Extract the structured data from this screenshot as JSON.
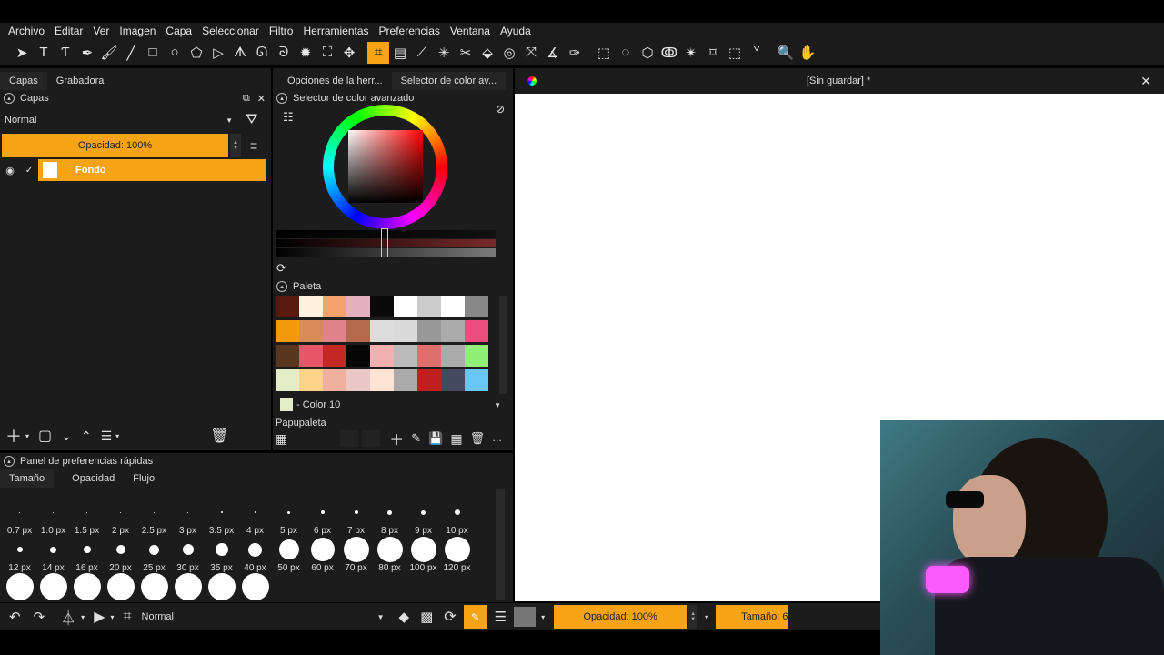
{
  "menu": [
    "Archivo",
    "Editar",
    "Ver",
    "Imagen",
    "Capa",
    "Seleccionar",
    "Filtro",
    "Herramientas",
    "Preferencias",
    "Ventana",
    "Ayuda"
  ],
  "toolbar_icons": [
    "select-arrow-icon",
    "text-icon",
    "transform-text-icon",
    "pen-icon",
    "brush-icon",
    "line-icon",
    "rectangle-icon",
    "ellipse-icon",
    "polygon-icon",
    "arrow-shape-icon",
    "bezier-icon",
    "lasso-curve-icon",
    "curve-icon",
    "spray-icon",
    "frame-icon",
    "move-icon",
    "crop-icon",
    "gradient-icon",
    "eyedropper-icon",
    "magic-icon",
    "scissors-icon",
    "fill-bucket-icon",
    "target-icon",
    "transform-icon",
    "ruler-icon",
    "pin-icon",
    "rect-select-icon",
    "ellipse-select-icon",
    "poly-select-icon",
    "freehand-select-icon",
    "magic-wand-icon",
    "select-transform-icon",
    "select-frame-icon",
    "select-curve-icon",
    "zoom-icon",
    "hand-icon"
  ],
  "left_tabs": [
    "Capas",
    "Grabadora"
  ],
  "layers": {
    "title": "Capas",
    "blend_mode": "Normal",
    "opacity_label": "Opacidad:  100%",
    "layer_name": "Fondo"
  },
  "mid_tabs": [
    "Opciones de la herr...",
    "Selector de color av..."
  ],
  "color_selector": {
    "title": "Selector de color avanzado"
  },
  "palette": {
    "title": "Paleta",
    "selected_color": "- Color 10",
    "papupaleta": "Papupaleta",
    "colors": [
      "#5a1a10",
      "#fff3e0",
      "#f4a26b",
      "#e4b0c0",
      "#0a0a0a",
      "#ffffff",
      "#cccccc",
      "#ffffff",
      "#888888",
      "#f39a0c",
      "#d98c5a",
      "#e0828a",
      "#b5694a",
      "#dcdcdc",
      "#d9d9d9",
      "#999999",
      "#aaaaaa",
      "#ec4d7f",
      "#5a3520",
      "#e8566a",
      "#c42825",
      "#060606",
      "#f4b0b0",
      "#bbbbbb",
      "#e07070",
      "#aaaaaa",
      "#8ef074",
      "#e4ecc8",
      "#ffd28a",
      "#f0b0a0",
      "#ebc8c8",
      "#ffe4d6",
      "#aaaaaa",
      "#c02020",
      "#444a60",
      "#6ac6f4"
    ]
  },
  "quick_prefs": {
    "title": "Panel de preferencias rápidas",
    "tabs": [
      "Tamaño",
      "Opacidad",
      "Flujo"
    ],
    "row1": [
      "0.7 px",
      "1.0 px",
      "1.5 px",
      "2 px",
      "2.5 px",
      "3 px",
      "3.5 px",
      "4 px",
      "5 px",
      "6 px",
      "7 px",
      "8 px",
      "9 px",
      "10 px"
    ],
    "row2": [
      "12 px",
      "14 px",
      "16 px",
      "20 px",
      "25 px",
      "30 px",
      "35 px",
      "40 px",
      "50 px",
      "60 px",
      "70 px",
      "80 px",
      "100 px",
      "120 px"
    ]
  },
  "canvas": {
    "title": "[Sin guardar] *"
  },
  "bottom": {
    "blend_mode": "Normal",
    "opacity_label": "Opacidad: 100%",
    "size_label": "Tamaño: 6"
  },
  "colors": {
    "accent": "#f7a316",
    "panel": "#1c1c1c",
    "canvas": "#ffffff"
  }
}
